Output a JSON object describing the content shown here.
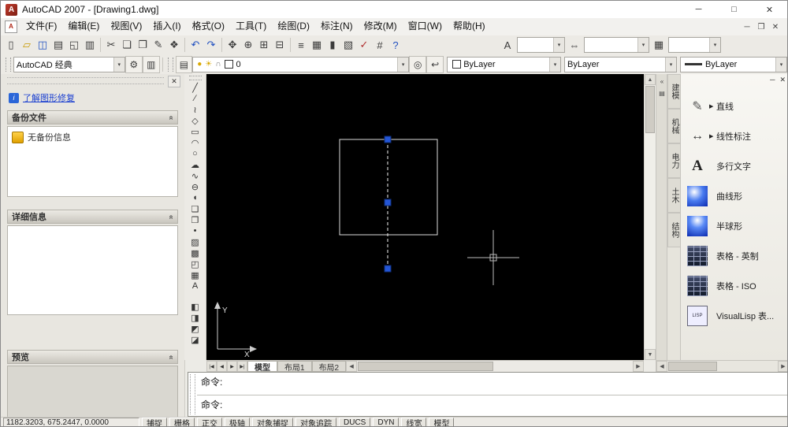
{
  "ui": {
    "dropdown_arrow": "▾",
    "scroll_up": "▲",
    "scroll_down": "▼",
    "scroll_left": "◀",
    "scroll_right": "▶"
  },
  "window": {
    "app_icon": "A",
    "title": "AutoCAD 2007 - [Drawing1.dwg]",
    "minimize": "─",
    "maximize": "□",
    "close": "✕"
  },
  "menubar": {
    "doc_icon": "A",
    "items": [
      "文件(F)",
      "编辑(E)",
      "视图(V)",
      "插入(I)",
      "格式(O)",
      "工具(T)",
      "绘图(D)",
      "标注(N)",
      "修改(M)",
      "窗口(W)",
      "帮助(H)"
    ],
    "mdi": {
      "minimize": "─",
      "restore": "❐",
      "close": "✕"
    }
  },
  "toolbar_standard": {
    "file": [
      {
        "name": "new-file-icon",
        "g": "▯"
      },
      {
        "name": "open-icon",
        "g": "▱",
        "c": "y"
      },
      {
        "name": "save-icon",
        "g": "◫",
        "c": "b"
      },
      {
        "name": "plot-icon",
        "g": "▤"
      },
      {
        "name": "plot-preview-icon",
        "g": "◱"
      },
      {
        "name": "publish-icon",
        "g": "▥"
      }
    ],
    "edit": [
      {
        "name": "cut-icon",
        "g": "✂"
      },
      {
        "name": "copy-icon",
        "g": "❏"
      },
      {
        "name": "paste-icon",
        "g": "❐"
      },
      {
        "name": "match-properties-icon",
        "g": "✎"
      },
      {
        "name": "block-editor-icon",
        "g": "❖"
      }
    ],
    "undo": [
      {
        "name": "undo-icon",
        "g": "↶",
        "c": "b"
      },
      {
        "name": "redo-icon",
        "g": "↷",
        "c": "b"
      }
    ],
    "zoom": [
      {
        "name": "pan-icon",
        "g": "✥"
      },
      {
        "name": "zoom-realtime-icon",
        "g": "⊕"
      },
      {
        "name": "zoom-window-icon",
        "g": "⊞"
      },
      {
        "name": "zoom-previous-icon",
        "g": "⊟"
      }
    ],
    "tools": [
      {
        "name": "properties-icon",
        "g": "≡"
      },
      {
        "name": "designcenter-icon",
        "g": "▦"
      },
      {
        "name": "tool-palettes-icon",
        "g": "▮"
      },
      {
        "name": "sheet-set-manager-icon",
        "g": "▧"
      },
      {
        "name": "markup-set-manager-icon",
        "g": "✓",
        "c": "r"
      },
      {
        "name": "quickcalc-icon",
        "g": "#"
      },
      {
        "name": "help-icon",
        "g": "?",
        "c": "b"
      }
    ]
  },
  "styles": [
    {
      "name": "text-style-combo",
      "icon_name": "text-style-icon",
      "icon": "A",
      "value": ""
    },
    {
      "name": "dim-style-combo",
      "icon_name": "dim-style-icon",
      "icon": "⇔",
      "value": ""
    },
    {
      "name": "table-style-combo",
      "icon_name": "table-style-icon",
      "icon": "▦",
      "value": ""
    }
  ],
  "toolbar_layers": {
    "workspace_value": "AutoCAD 经典",
    "workspace_buttons": [
      {
        "name": "workspace-settings-icon",
        "g": "⚙"
      },
      {
        "name": "workspace-save-icon",
        "g": "▥"
      }
    ],
    "layer_manager_icon": "▤",
    "layer_combo": {
      "bulb": "●",
      "sun": "☀",
      "lock": "∩",
      "layer_name": "0"
    },
    "layer_buttons": [
      {
        "name": "make-object-layer-current-icon",
        "g": "◎"
      },
      {
        "name": "layer-previous-icon",
        "g": "↩"
      }
    ],
    "color_value": "ByLayer",
    "linetype_value": "ByLayer",
    "lineweight_value": "ByLayer"
  },
  "panel": {
    "close": "✕",
    "info_icon": "i",
    "link": "了解图形修复",
    "chevron": "«",
    "backup_title": "备份文件",
    "backup_empty": "无备份信息",
    "details_title": "详细信息",
    "preview_title": "预览"
  },
  "draw_toolbar": {
    "group1": [
      {
        "name": "line-icon",
        "g": "╱"
      },
      {
        "name": "construction-line-icon",
        "g": "∕"
      },
      {
        "name": "polyline-icon",
        "g": "≀"
      },
      {
        "name": "polygon-icon",
        "g": "◇"
      },
      {
        "name": "rectangle-icon",
        "g": "▭"
      },
      {
        "name": "arc-icon",
        "g": "◠"
      },
      {
        "name": "circle-icon",
        "g": "○"
      },
      {
        "name": "revision-cloud-icon",
        "g": "☁"
      },
      {
        "name": "spline-icon",
        "g": "∿"
      },
      {
        "name": "ellipse-icon",
        "g": "⊖"
      },
      {
        "name": "ellipse-arc-icon",
        "g": "◖"
      },
      {
        "name": "insert-block-icon",
        "g": "❑"
      },
      {
        "name": "make-block-icon",
        "g": "❒"
      },
      {
        "name": "point-icon",
        "g": "•"
      },
      {
        "name": "hatch-icon",
        "g": "▨"
      },
      {
        "name": "gradient-icon",
        "g": "▩"
      },
      {
        "name": "region-icon",
        "g": "◰"
      },
      {
        "name": "table-icon",
        "g": "▦"
      },
      {
        "name": "multiline-text-icon",
        "g": "A"
      }
    ],
    "group2": [
      {
        "name": "draw-order-front-icon",
        "g": "◧"
      },
      {
        "name": "draw-order-back-icon",
        "g": "◨"
      },
      {
        "name": "draw-order-above-icon",
        "g": "◩"
      },
      {
        "name": "draw-order-below-icon",
        "g": "◪"
      }
    ]
  },
  "canvas": {
    "ucs_x": "X",
    "ucs_y": "Y"
  },
  "model_tabs": {
    "nav": [
      {
        "name": "first-tab-button",
        "g": "|◀"
      },
      {
        "name": "prev-tab-button",
        "g": "◀"
      },
      {
        "name": "next-tab-button",
        "g": "▶"
      },
      {
        "name": "last-tab-button",
        "g": "▶|"
      }
    ],
    "tabs": [
      {
        "name": "model-tab",
        "label": "模型",
        "k": "active"
      },
      {
        "name": "layout1-tab",
        "label": "布局1"
      },
      {
        "name": "layout2-tab",
        "label": "布局2"
      }
    ]
  },
  "palette": {
    "titlebar_icons": [
      {
        "name": "palette-autohide-icon",
        "g": "«"
      },
      {
        "name": "palette-properties-icon",
        "g": "▤"
      }
    ],
    "minimize": "─",
    "close": "✕",
    "tabs": [
      "建模",
      "机械",
      "电力",
      "土木",
      "结构"
    ],
    "items": [
      {
        "name": "palette-item-line",
        "k": "pen",
        "g": "✎",
        "fly": "▶",
        "label": "直线"
      },
      {
        "name": "palette-item-linear-dimension",
        "k": "dim",
        "g": "↔",
        "fly": "▶",
        "label": "线性标注"
      },
      {
        "name": "palette-item-mtext",
        "k": "text",
        "g": "A",
        "label": "多行文字"
      },
      {
        "name": "palette-item-curved",
        "k": "grad",
        "label": "曲线形"
      },
      {
        "name": "palette-item-hemisphere",
        "k": "grad2",
        "label": "半球形"
      },
      {
        "name": "palette-item-table-imperial",
        "k": "table",
        "label": "表格 - 英制"
      },
      {
        "name": "palette-item-table-iso",
        "k": "table",
        "label": "表格 - ISO"
      },
      {
        "name": "palette-item-visuallisp",
        "k": "lisp",
        "g": "LISP",
        "label": "VisualLisp 表..."
      }
    ]
  },
  "command": {
    "history": "命令:",
    "prompt": "命令:"
  },
  "statusbar": {
    "coords": "1182.3203, 675.2447, 0.0000",
    "toggles": [
      {
        "name": "snap-toggle",
        "label": "捕捉"
      },
      {
        "name": "grid-toggle",
        "label": "栅格"
      },
      {
        "name": "ortho-toggle",
        "label": "正交"
      },
      {
        "name": "polar-toggle",
        "label": "极轴"
      },
      {
        "name": "osnap-toggle",
        "label": "对象捕捉"
      },
      {
        "name": "otrack-toggle",
        "label": "对象追踪"
      },
      {
        "name": "ducs-toggle",
        "label": "DUCS"
      },
      {
        "name": "dyn-toggle",
        "label": "DYN"
      },
      {
        "name": "lineweight-toggle",
        "label": "线宽"
      },
      {
        "name": "model-toggle",
        "label": "模型"
      }
    ]
  }
}
